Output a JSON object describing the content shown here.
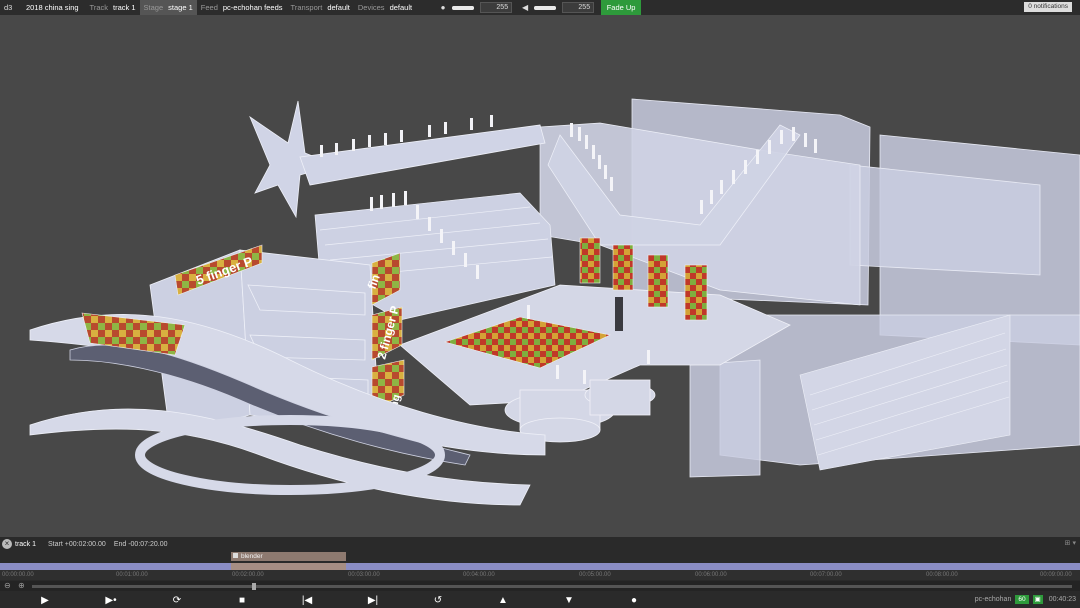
{
  "app": {
    "name": "d3",
    "project": "2018 china sing"
  },
  "topbar": {
    "segments": [
      {
        "key": "Track",
        "value": "track 1"
      },
      {
        "key": "Stage",
        "value": "stage 1"
      },
      {
        "key": "Feed",
        "value": "pc-echohan feeds"
      },
      {
        "key": "Transport",
        "value": "default"
      },
      {
        "key": "Devices",
        "value": "default"
      }
    ],
    "brightness": {
      "icon": "brightness-icon",
      "value": "255",
      "level": 1.0
    },
    "volume": {
      "icon": "volume-icon",
      "value": "255",
      "level": 1.0
    },
    "fade_label": "Fade Up",
    "notifications_label": "0 notifications"
  },
  "viewport": {
    "screen_labels": [
      "5 finger P",
      "fin",
      "2 finger P",
      "fing"
    ]
  },
  "timeline": {
    "track_name": "track 1",
    "start": "Start +00:02:00.00",
    "end": "End -00:07:20.00",
    "layer_name": "blender",
    "tick_labels": [
      "00:00:00.00",
      "00:01:00.00",
      "00:02:00.00",
      "00:03:00.00",
      "00:04:00.00",
      "00:05:00.00",
      "00:06:00.00",
      "00:07:00.00",
      "00:08:00.00",
      "00:09:00.00"
    ],
    "machine": "pc-echohan",
    "fps": "60",
    "time": "00:40:23"
  },
  "colors": {
    "accent_green": "#2e9a3b",
    "ruler": "#8a8dc4",
    "layer": "#8e7a70",
    "stage": "#c8cce0"
  }
}
